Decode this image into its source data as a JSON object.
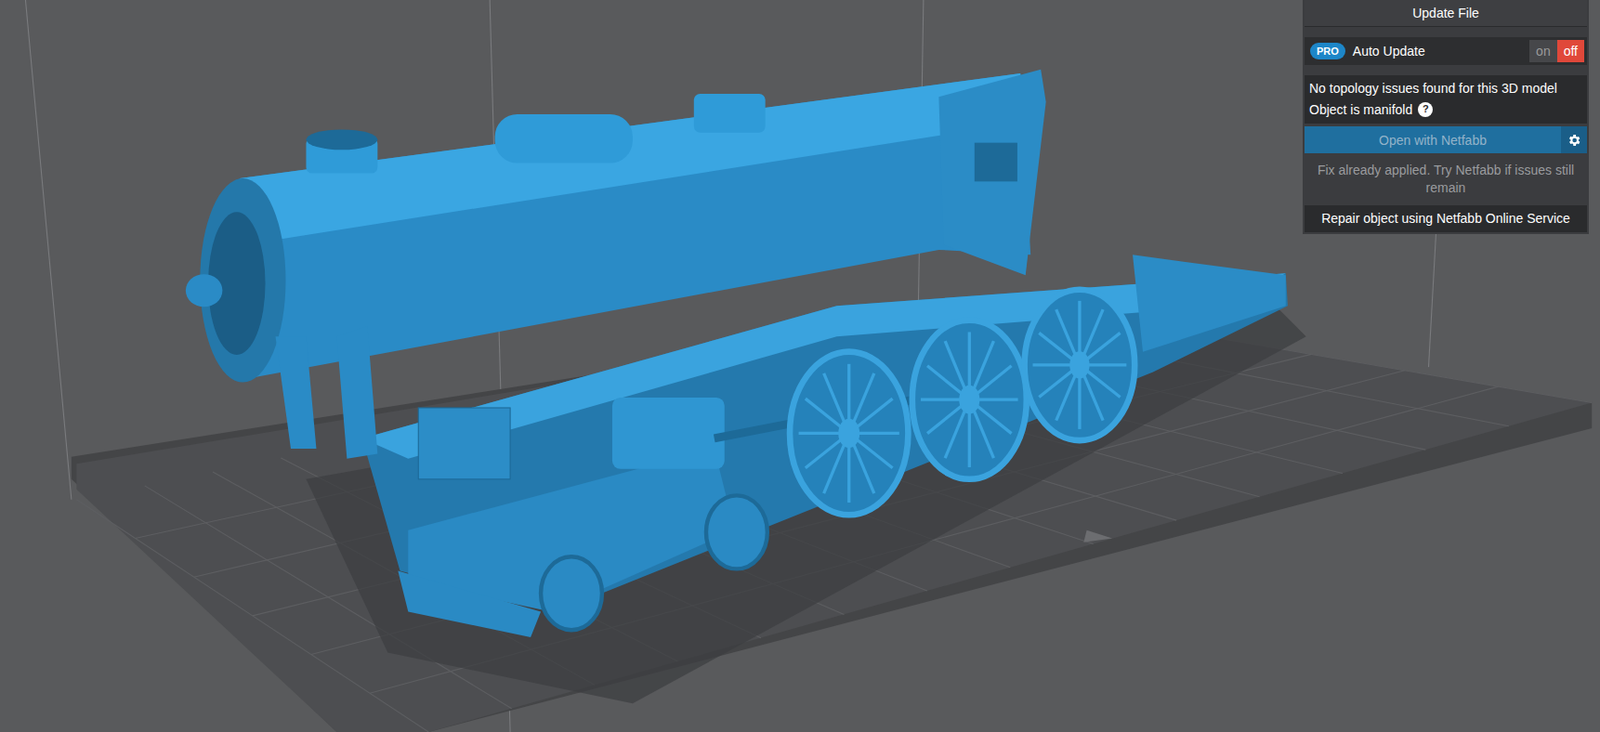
{
  "viewport": {
    "model": "steam locomotive",
    "tool": "3D model viewer"
  },
  "panel": {
    "update_button": "Update File",
    "auto_update": {
      "badge": "PRO",
      "label": "Auto Update",
      "options": [
        {
          "label": "on",
          "selected": false
        },
        {
          "label": "off",
          "selected": true
        }
      ]
    },
    "status": {
      "message": "No topology issues found for this 3D model",
      "manifold": "Object is manifold",
      "help": "?"
    },
    "open_button": {
      "label": "Open with Netfabb",
      "disabled": true
    },
    "note": "Fix already applied. Try Netfabb if issues still remain",
    "repair_button": "Repair object using Netfabb Online Service"
  }
}
